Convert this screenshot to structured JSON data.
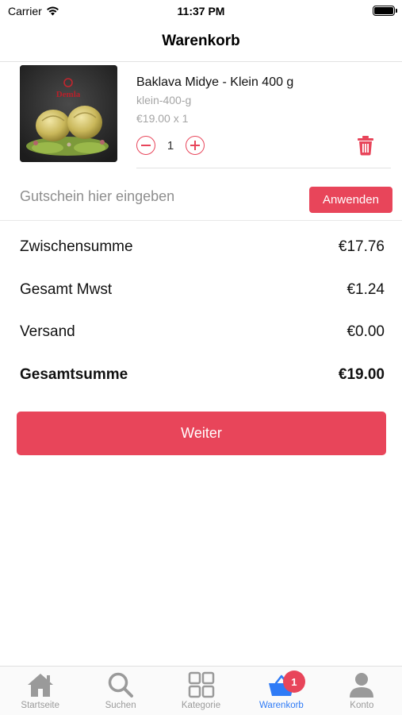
{
  "status_bar": {
    "carrier": "Carrier",
    "time": "11:37 PM"
  },
  "nav": {
    "title": "Warenkorb"
  },
  "cart": {
    "items": [
      {
        "name": "Baklava Midye - Klein 400 g",
        "variant": "klein-400-g",
        "price_line": "€19.00 x 1",
        "quantity": "1",
        "image_logo_text": "Demla"
      }
    ]
  },
  "coupon": {
    "placeholder": "Gutschein hier eingeben",
    "value": "",
    "apply_label": "Anwenden"
  },
  "summary": {
    "subtotal_label": "Zwischensumme",
    "subtotal_value": "€17.76",
    "tax_label": "Gesamt Mwst",
    "tax_value": "€1.24",
    "shipping_label": "Versand",
    "shipping_value": "€0.00",
    "total_label": "Gesamtsumme",
    "total_value": "€19.00"
  },
  "continue_label": "Weiter",
  "tab_bar": {
    "tabs": [
      {
        "label": "Startseite",
        "icon": "home-icon"
      },
      {
        "label": "Suchen",
        "icon": "search-icon"
      },
      {
        "label": "Kategorie",
        "icon": "grid-icon"
      },
      {
        "label": "Warenkorb",
        "icon": "basket-icon",
        "badge": "1",
        "active": true
      },
      {
        "label": "Konto",
        "icon": "user-icon"
      }
    ]
  },
  "colors": {
    "accent": "#e8455a",
    "active_tab": "#2f7bf6",
    "inactive_tab": "#9a9a9a"
  }
}
